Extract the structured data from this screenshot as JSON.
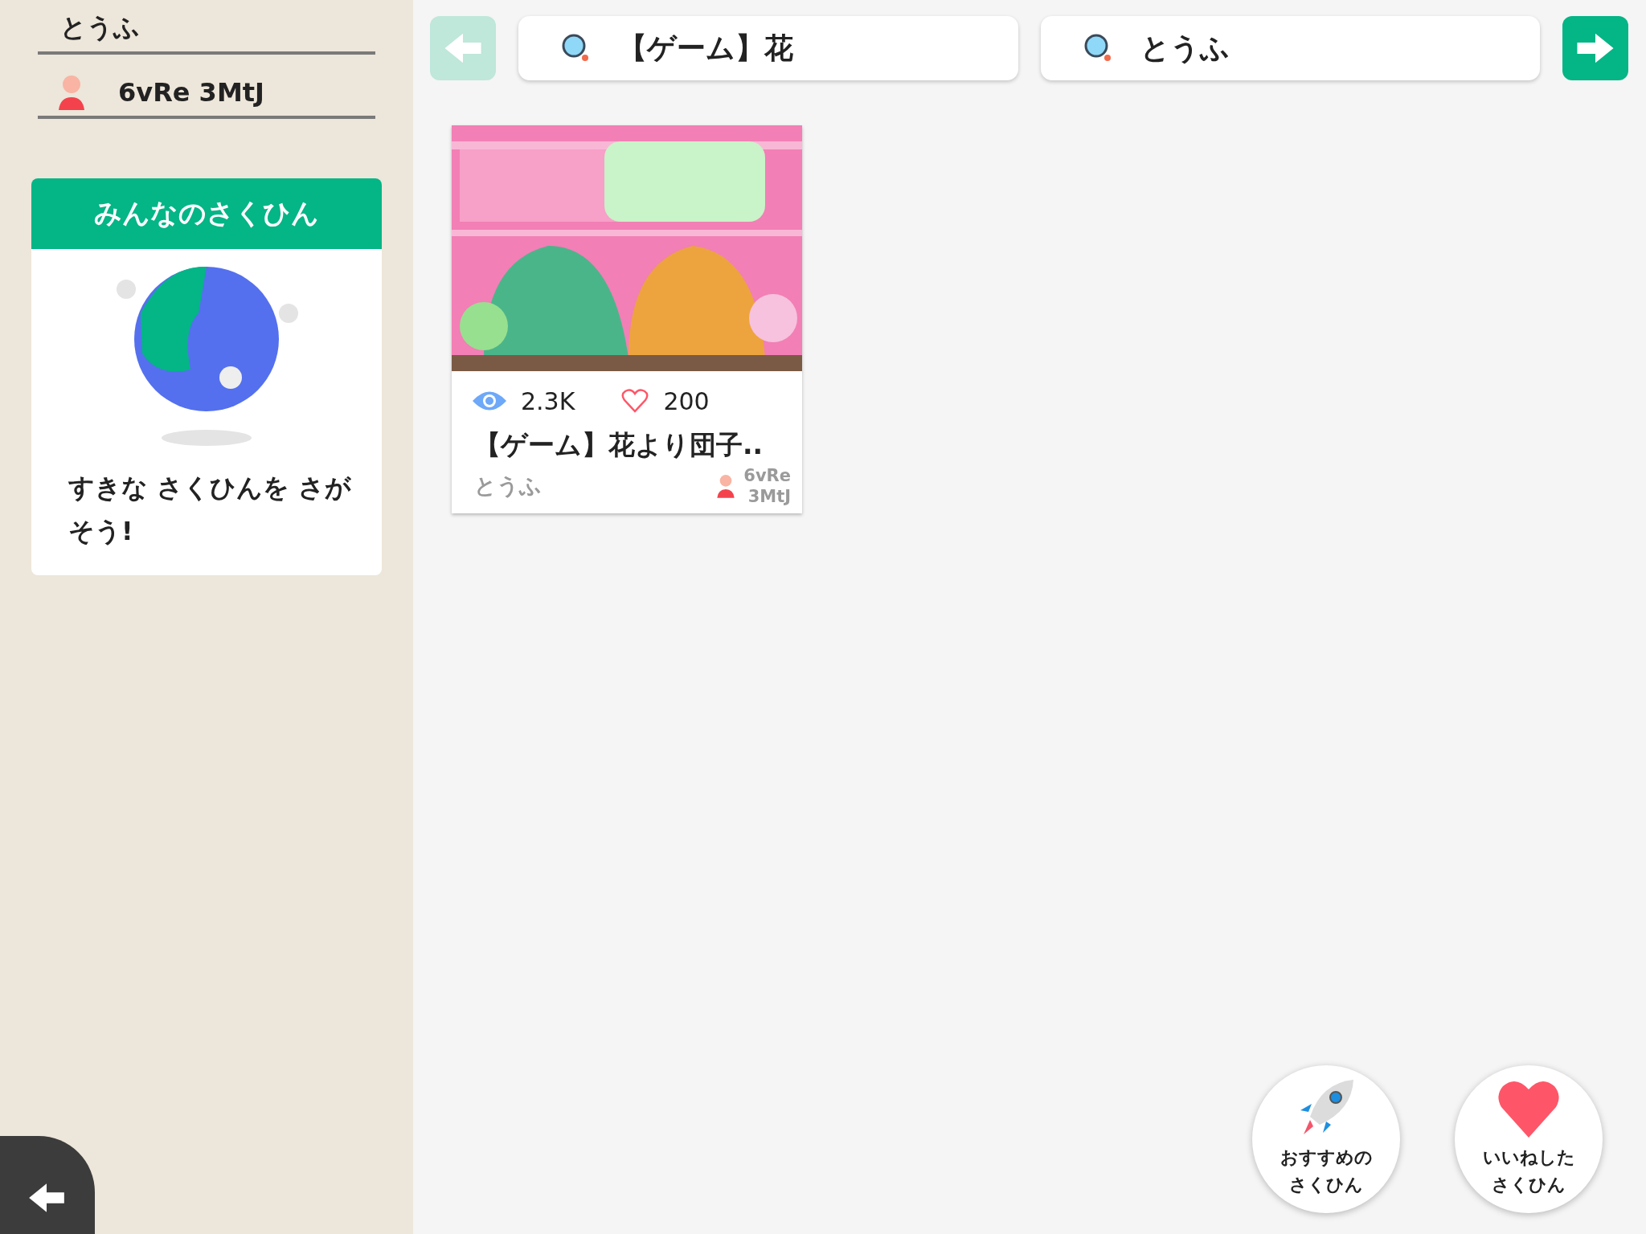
{
  "sidebar": {
    "username_field": {
      "value": "とうふ"
    },
    "user_id_field": {
      "value": "6vRe 3MtJ"
    },
    "gallery_card": {
      "title": "みんなのさくひん",
      "message": "すきな さくひんを さがそう!"
    }
  },
  "toolbar": {
    "back_button": {
      "disabled": true
    },
    "search_fields": [
      {
        "value": "【ゲーム】花"
      },
      {
        "value": "とうふ"
      }
    ],
    "go_button": {
      "disabled": false
    }
  },
  "results": [
    {
      "views": "2.3K",
      "likes": "200",
      "title": "【ゲーム】花より団子..",
      "author": "とうふ",
      "user_id": "6vRe\n3MtJ"
    }
  ],
  "floating_buttons": [
    {
      "kind": "recommended",
      "label_lines": [
        "おすすめの",
        "さくひん"
      ]
    },
    {
      "kind": "liked",
      "label_lines": [
        "いいねした",
        "さくひん"
      ]
    }
  ]
}
